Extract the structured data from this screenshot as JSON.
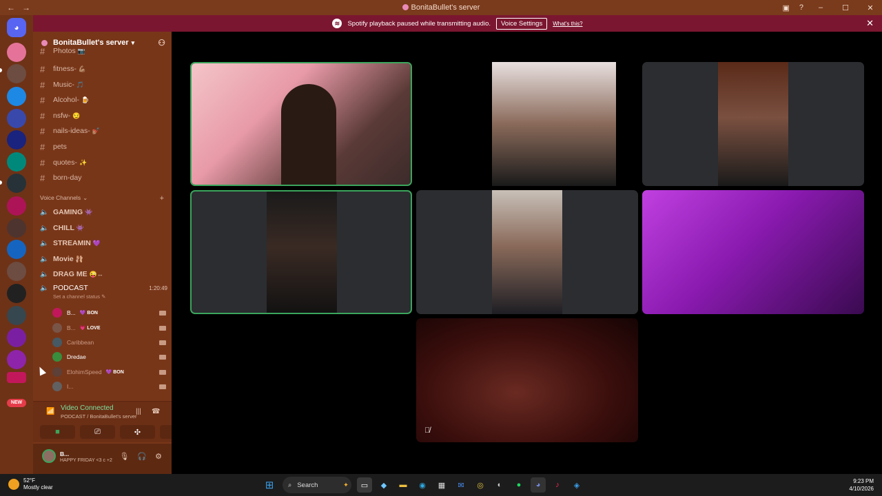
{
  "window": {
    "title": "BonitaBullet's server"
  },
  "banner": {
    "message": "Spotify playback paused while transmitting audio.",
    "button": "Voice Settings",
    "link": "What's this?"
  },
  "server": {
    "name": "BonitaBullet's server"
  },
  "text_channels": [
    {
      "name": "Photos",
      "emoji": "📷"
    },
    {
      "name": "fitness-",
      "emoji": "💪🏽"
    },
    {
      "name": "Music-",
      "emoji": "🎵"
    },
    {
      "name": "Alcohol-",
      "emoji": "🍺"
    },
    {
      "name": "nsfw-",
      "emoji": "😏"
    },
    {
      "name": "nails-ideas-",
      "emoji": "💅🏽"
    },
    {
      "name": "pets",
      "emoji": ""
    },
    {
      "name": "quotes-",
      "emoji": "✨"
    },
    {
      "name": "born-day",
      "emoji": ""
    }
  ],
  "voice_category": "Voice Channels",
  "voice_channels": [
    {
      "name": "GAMING",
      "emoji": "👾"
    },
    {
      "name": "CHILL",
      "emoji": "👾"
    },
    {
      "name": "STREAMIN",
      "emoji": "💜"
    },
    {
      "name": "Movie",
      "emoji": "🩰"
    },
    {
      "name": "DRAG ME",
      "emoji": "😜↔"
    }
  ],
  "podcast": {
    "name": "PODCAST",
    "timer": "1:20:49",
    "status": "Set a channel status"
  },
  "members": [
    {
      "name": "B...",
      "tag": "💜 BON",
      "color": "#c2185b"
    },
    {
      "name": "B...",
      "tag": "💗 LOVE",
      "color": "#795548"
    },
    {
      "name": "Caribbean",
      "tag": "",
      "color": "#455a64"
    },
    {
      "name": "Dredae",
      "tag": "",
      "color": "#388e3c"
    },
    {
      "name": "ElohimSpeed",
      "tag": "💜 BON",
      "color": "#5d4037"
    },
    {
      "name": "I...",
      "tag": "",
      "color": "#616161"
    }
  ],
  "voice_connection": {
    "status": "Video Connected",
    "location": "PODCAST / BonitaBullet's server"
  },
  "user": {
    "name": "B...",
    "status": "HAPPY FRIDAY <3 c +2"
  },
  "taskbar": {
    "weather_temp": "52°F",
    "weather_desc": "Mostly clear",
    "search_placeholder": "Search",
    "time": "9:23 PM",
    "date": "4/10/2026"
  },
  "new_badge": "NEW",
  "colors": {
    "titlebar": "#7a3a1c",
    "banner": "#7b1630",
    "sidebar": "#783619",
    "speaking": "#3ba55c"
  }
}
